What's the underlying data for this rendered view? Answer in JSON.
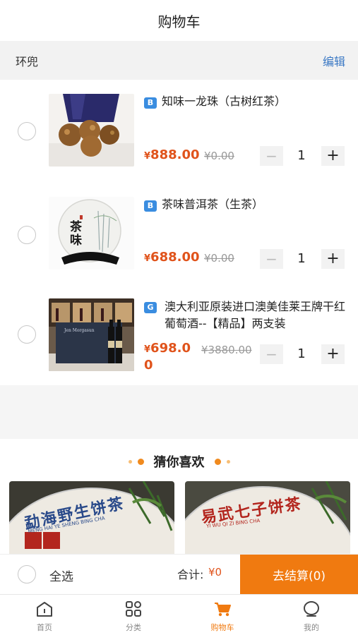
{
  "header": {
    "title": "购物车"
  },
  "shop": {
    "name": "环兜",
    "edit_label": "编辑"
  },
  "cart_items": [
    {
      "tag": "B",
      "name": "知味一龙珠（古树红茶）",
      "price_yen": "¥",
      "price": "888.00",
      "original": "¥0.00",
      "qty": "1",
      "minus": "−",
      "plus": "+"
    },
    {
      "tag": "B",
      "name": "茶味普洱茶（生茶）",
      "price_yen": "¥",
      "price": "688.00",
      "original": "¥0.00",
      "qty": "1",
      "minus": "−",
      "plus": "+"
    },
    {
      "tag": "G",
      "name": "澳大利亚原装进口澳美佳莱王牌干红葡萄酒--【精品】两支装",
      "price_yen": "¥",
      "price": "698.00",
      "original": "¥3880.00",
      "qty": "1",
      "minus": "−",
      "plus": "+"
    }
  ],
  "guess": {
    "title": "猜你喜欢"
  },
  "images": {
    "puer_cake_text": "茶味",
    "rec1_text": "勐海野生饼茶",
    "rec1_sub": "MENG HAI YE SHENG BING CHA",
    "rec2_text": "易武七子饼茶",
    "rec2_sub": "YI WU QI ZI BING CHA",
    "wine_box_label": "Jen Morgasun"
  },
  "checkout": {
    "select_all": "全选",
    "total_label": "合计:",
    "total_value": "¥0",
    "button": "去结算(0)"
  },
  "tabbar": [
    {
      "label": "首页",
      "icon": "home-icon"
    },
    {
      "label": "分类",
      "icon": "category-icon"
    },
    {
      "label": "购物车",
      "icon": "cart-icon",
      "active": true
    },
    {
      "label": "我的",
      "icon": "profile-icon"
    }
  ],
  "colors": {
    "accent": "#f07a10",
    "price": "#e0531b",
    "link": "#3a78c4",
    "tag": "#3a8de0"
  }
}
